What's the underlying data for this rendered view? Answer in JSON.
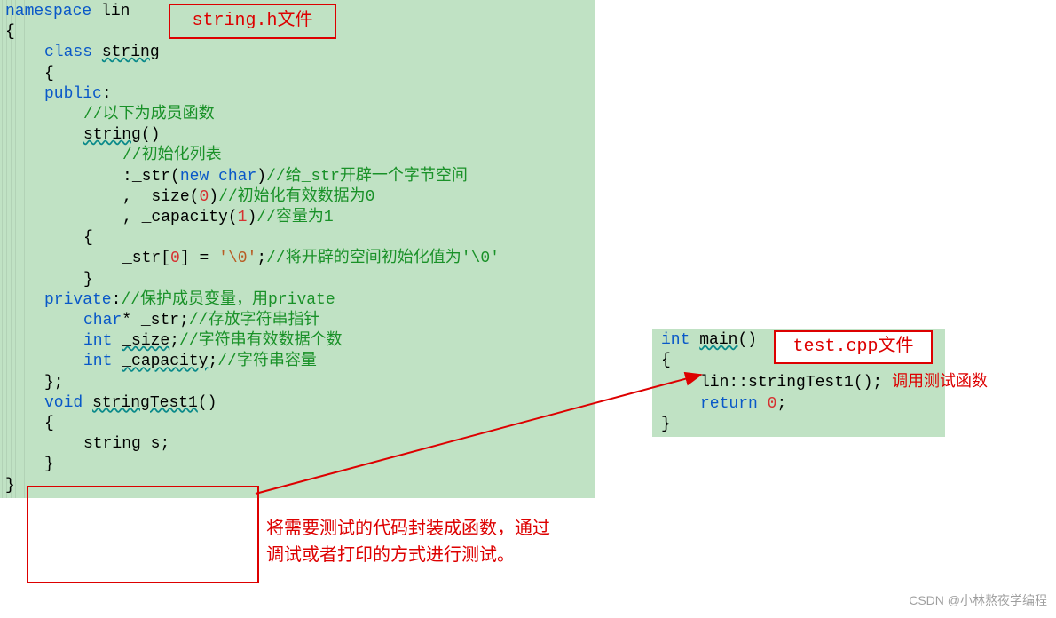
{
  "left": {
    "lines": [
      "namespace lin",
      "{",
      "    class string",
      "    {",
      "    public:",
      "        //以下为成员函数",
      "        string()",
      "            //初始化列表",
      "            :_str(new char)//给_str开辟一个字节空间",
      "            , _size(0)//初始化有效数据为0",
      "            , _capacity(1)//容量为1",
      "        {",
      "            _str[0] = '\\0';//将开辟的空间初始化值为'\\0'",
      "        }",
      "    private://保护成员变量，用private",
      "        char* _str;//存放字符串指针",
      "        int _size;//字符串有效数据个数",
      "        int _capacity;//字符串容量",
      "    };",
      "    void stringTest1()",
      "    {",
      "        string s;",
      "    }",
      "}"
    ]
  },
  "right": {
    "lines": [
      "int main()",
      "{",
      "    lin::stringTest1(); 调用测试函数",
      "    return 0;",
      "}"
    ]
  },
  "labels": {
    "string_h": "string.h文件",
    "test_cpp": "test.cpp文件",
    "note_line1": "将需要测试的代码封装成函数，通过",
    "note_line2": "调试或者打印的方式进行测试。",
    "right_inline_note": "调用测试函数"
  },
  "watermark": "CSDN @小林熬夜学编程"
}
